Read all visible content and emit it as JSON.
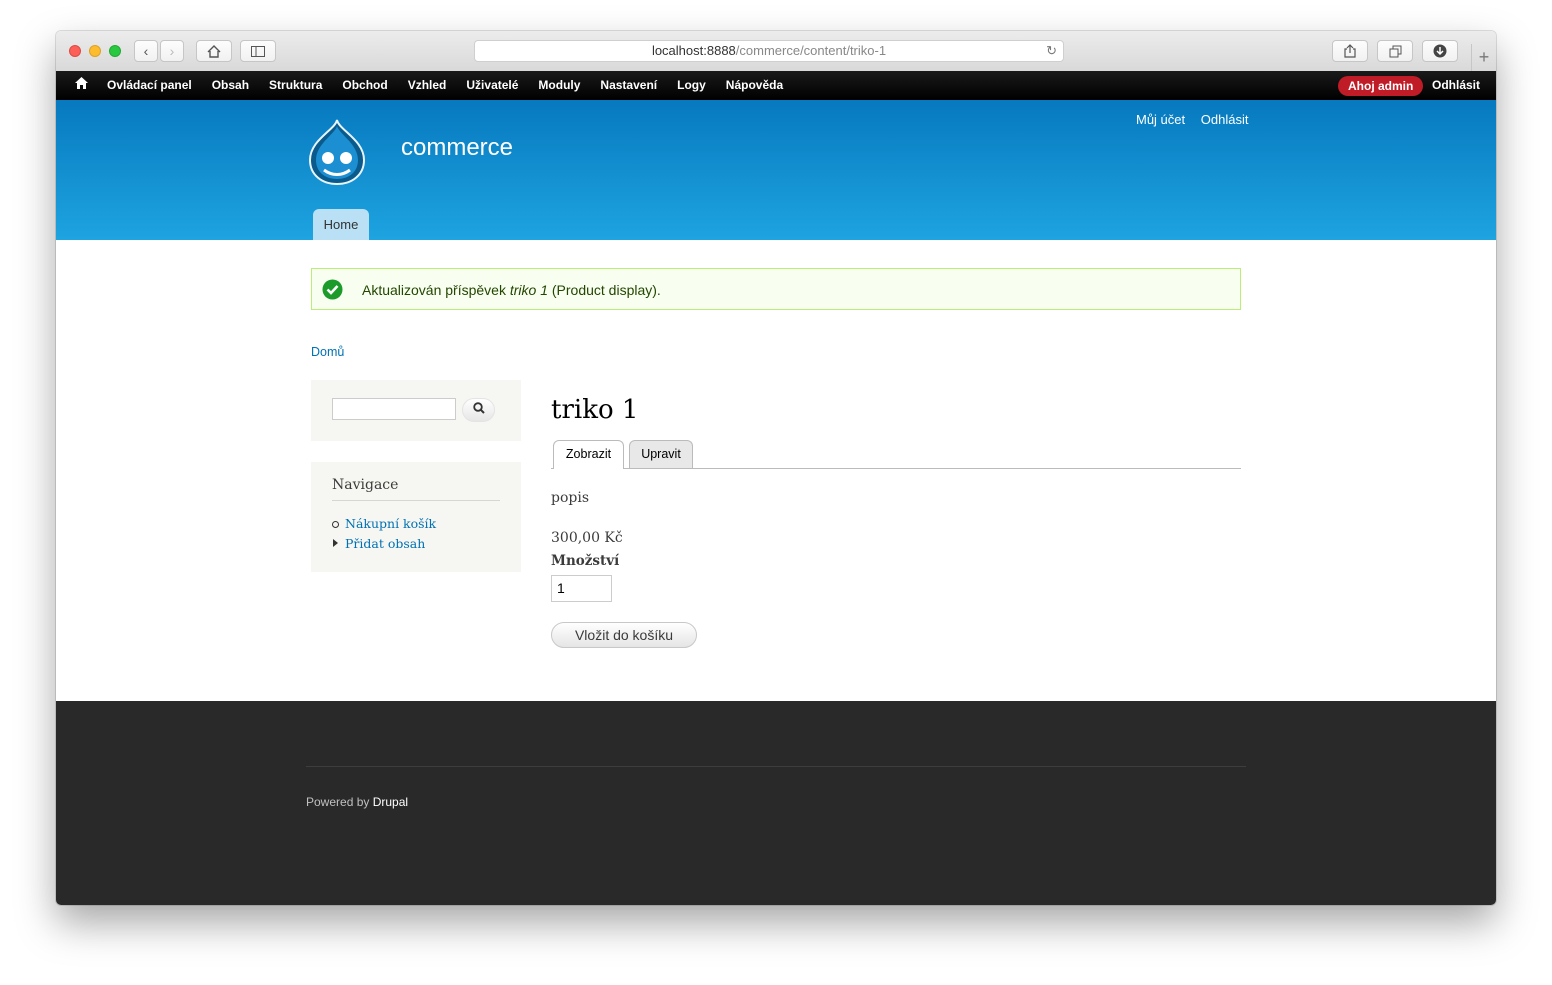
{
  "browser": {
    "url_host": "localhost:8888",
    "url_path": "/commerce/content/triko-1"
  },
  "toolbar": {
    "items": [
      "Ovládací panel",
      "Obsah",
      "Struktura",
      "Obchod",
      "Vzhled",
      "Uživatelé",
      "Moduly",
      "Nastavení",
      "Logy",
      "Nápověda"
    ],
    "hello": "Ahoj admin",
    "logout": "Odhlásit"
  },
  "header": {
    "site_name": "commerce",
    "secondary": [
      "Můj účet",
      "Odhlásit"
    ],
    "main_tab": "Home"
  },
  "message": {
    "prefix": "Aktualizován příspěvek ",
    "title": "triko 1",
    "suffix": " (Product display)."
  },
  "breadcrumb": "Domů",
  "sidebar": {
    "navigation_title": "Navigace",
    "links": [
      "Nákupní košík",
      "Přidat obsah"
    ]
  },
  "node": {
    "title": "triko 1",
    "tabs": [
      "Zobrazit",
      "Upravit"
    ],
    "body": "popis",
    "price": "300,00 Kč",
    "quantity_label": "Množství",
    "quantity_value": "1",
    "add_to_cart": "Vložit do košíku"
  },
  "footer": {
    "powered_prefix": "Powered by ",
    "powered_link": "Drupal"
  },
  "colors": {
    "toolbar_bg": "#000000",
    "header_top": "#0779bf",
    "header_bottom": "#1ea4e0",
    "admin_badge": "#bf1c27",
    "link": "#0071b3",
    "footer_bg": "#292929"
  },
  "icons": {
    "home": "home-icon",
    "search": "search-icon",
    "status_ok": "check-circle-icon",
    "logo": "drupal-drop-icon"
  }
}
